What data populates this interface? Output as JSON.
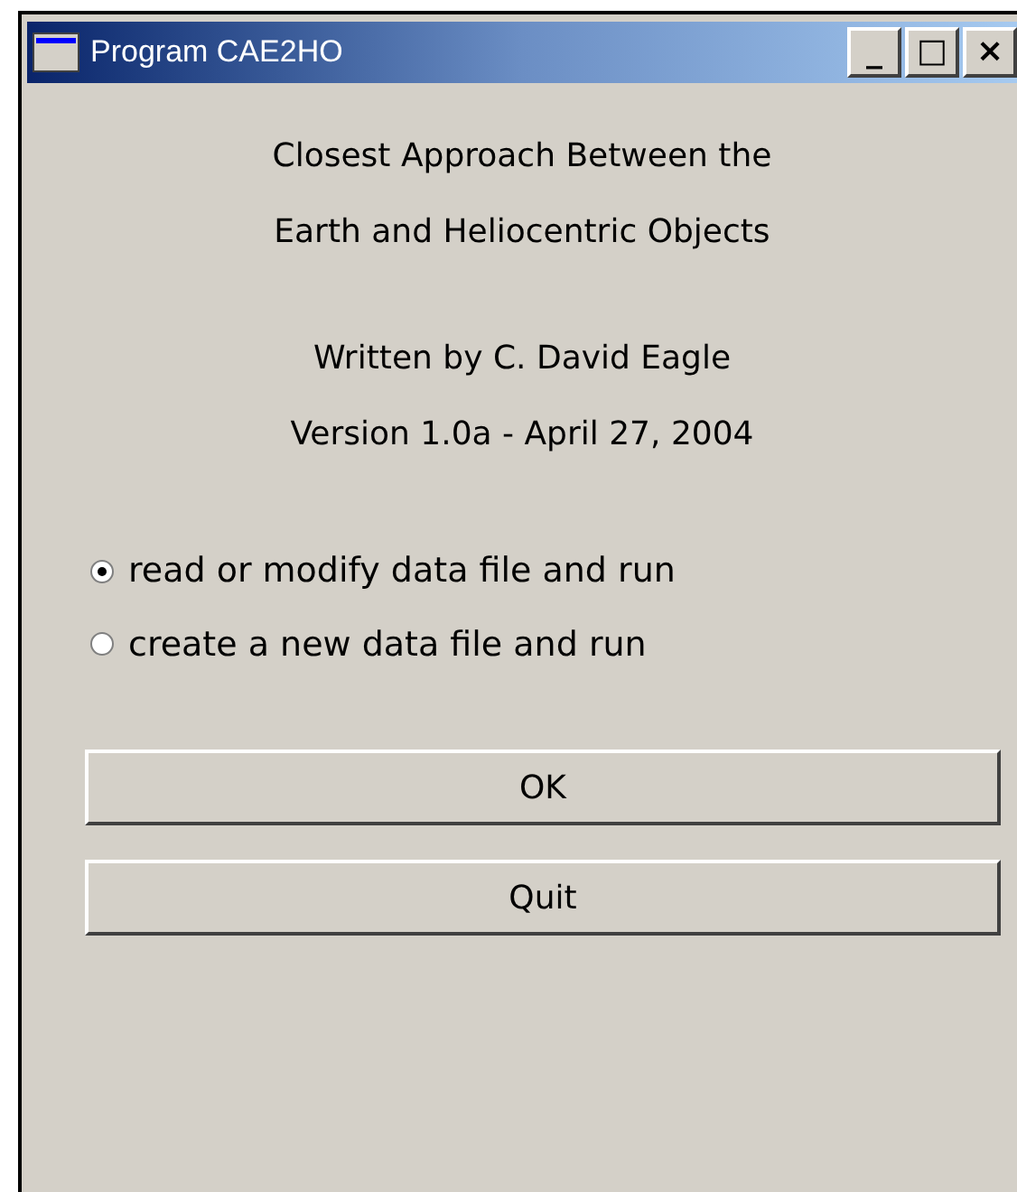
{
  "window": {
    "title": "Program CAE2HO",
    "controls": [
      "_",
      "□",
      "×"
    ]
  },
  "heading_lines": [
    "Closest Approach Between the",
    "Earth and Heliocentric Objects"
  ],
  "credit_lines": [
    "Written by C. David Eagle",
    "Version 1.0a - April 27, 2004"
  ],
  "options": [
    {
      "label": "read or modify data file and run",
      "selected": true
    },
    {
      "label": "create a new data file and run",
      "selected": false
    }
  ],
  "buttons": [
    "OK",
    "Quit"
  ]
}
